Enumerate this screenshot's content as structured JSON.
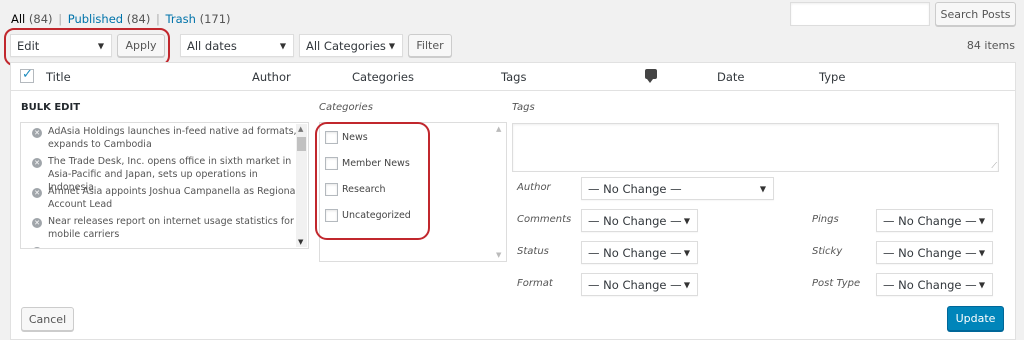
{
  "views": {
    "all_label": "All",
    "all_count": "(84)",
    "sep": "|",
    "published_label": "Published",
    "published_count": "(84)",
    "trash_label": "Trash",
    "trash_count": "(171)"
  },
  "search": {
    "value": "",
    "button_label": "Search Posts"
  },
  "bulk_actions": {
    "selected": "Edit",
    "apply_label": "Apply"
  },
  "filters": {
    "dates": "All dates",
    "categories": "All Categories",
    "filter_label": "Filter"
  },
  "items_count": "84 items",
  "table_headers": {
    "title": "Title",
    "author": "Author",
    "categories": "Categories",
    "tags": "Tags",
    "date": "Date",
    "type": "Type"
  },
  "bulk_edit": {
    "heading": "BULK EDIT",
    "posts": [
      "AdAsia Holdings launches in-feed native ad formats, expands to Cambodia",
      "The Trade Desk, Inc. opens office in sixth market in Asia-Pacific and Japan, sets up operations in Indonesia",
      "Amnet Asia appoints Joshua Campanella as Regional Account Lead",
      "Near releases report on internet usage statistics for mobile carriers"
    ],
    "categories_label": "Categories",
    "categories": [
      "News",
      "Member News",
      "Research",
      "Uncategorized"
    ],
    "tags_label": "Tags",
    "author_label": "Author",
    "author_value": "— No Change —",
    "comments_label": "Comments",
    "comments_value": "— No Change —",
    "status_label": "Status",
    "status_value": "— No Change —",
    "format_label": "Format",
    "format_value": "— No Change —",
    "pings_label": "Pings",
    "pings_value": "— No Change —",
    "sticky_label": "Sticky",
    "sticky_value": "— No Change —",
    "post_type_label": "Post Type",
    "post_type_value": "— No Change —",
    "cancel_label": "Cancel",
    "update_label": "Update"
  },
  "icons": {
    "checkbox": "checkbox-checked-icon",
    "comments": "comment-bubble-icon",
    "remove": "remove-circle-icon"
  },
  "colors": {
    "accent": "#0073aa",
    "primary_button": "#0085ba",
    "annotation_ring": "#c1272d"
  }
}
